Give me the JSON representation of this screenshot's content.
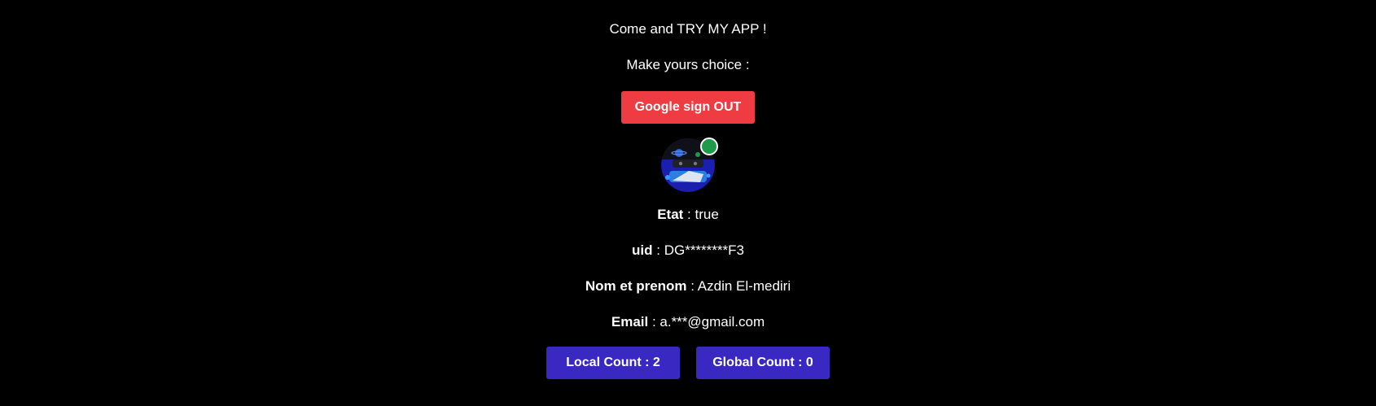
{
  "intro_text": "Come and TRY MY APP !",
  "prompt_text": "Make yours choice :",
  "signout_label": "Google sign OUT",
  "avatar": {
    "icon": "user-avatar-icon",
    "status_icon": "online-status-icon"
  },
  "profile": {
    "etat_label": "Etat",
    "etat_value": "true",
    "uid_label": "uid",
    "uid_value": "DG********F3",
    "name_label": "Nom et prenom",
    "name_value": "Azdin El-mediri",
    "email_label": "Email",
    "email_value": "a.***@gmail.com",
    "separator": " : "
  },
  "counts": {
    "local_label": "Local Count : 2",
    "global_label": "Global Count : 0"
  },
  "colors": {
    "background": "#000000",
    "signout_button": "#ef3b42",
    "count_button": "#3a28c2",
    "online_status": "#1f9a48"
  }
}
